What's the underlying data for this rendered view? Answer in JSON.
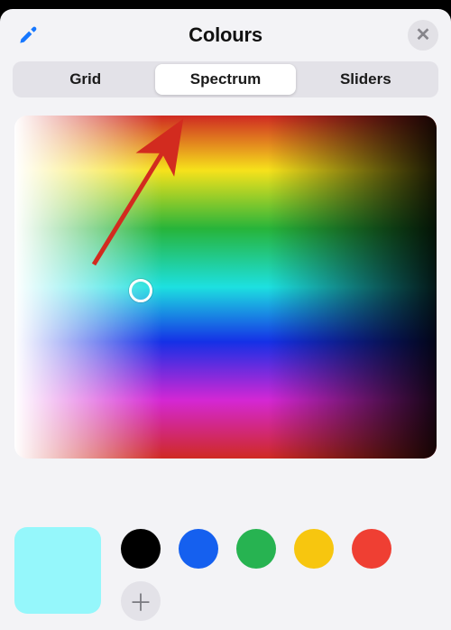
{
  "header": {
    "title": "Colours"
  },
  "tabs": {
    "items": [
      {
        "label": "Grid"
      },
      {
        "label": "Spectrum"
      },
      {
        "label": "Sliders"
      }
    ],
    "active_index": 1
  },
  "spectrum": {
    "picker_position": {
      "x_pct": 30,
      "y_pct": 51
    }
  },
  "current_color": "#95f7fb",
  "preset_swatches": [
    "#000000",
    "#1560ef",
    "#27b351",
    "#f7c60f",
    "#ef3f33"
  ],
  "annotation": {
    "arrow_target": "tab-spectrum",
    "arrow_color": "#d22b1f"
  }
}
